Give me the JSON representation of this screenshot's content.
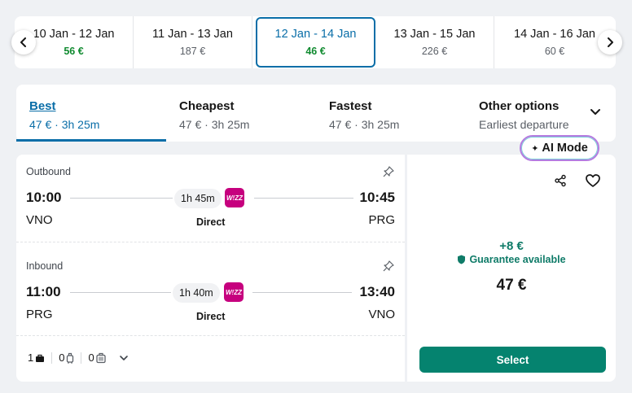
{
  "date_strip": {
    "dates": [
      {
        "range": "10 Jan - 12 Jan",
        "price": "56 €"
      },
      {
        "range": "11 Jan - 13 Jan",
        "price": "187 €"
      },
      {
        "range": "12 Jan - 14 Jan",
        "price": "46 €"
      },
      {
        "range": "13 Jan - 15 Jan",
        "price": "226 €"
      },
      {
        "range": "14 Jan - 16 Jan",
        "price": "60 €"
      }
    ],
    "prev_icon": "chevron-left-icon",
    "next_icon": "chevron-right-icon"
  },
  "sort_tabs": [
    {
      "title": "Best",
      "subtitle": "47 € · 3h 25m"
    },
    {
      "title": "Cheapest",
      "subtitle": "47 € · 3h 25m"
    },
    {
      "title": "Fastest",
      "subtitle": "47 € · 3h 25m"
    },
    {
      "title": "Other options",
      "subtitle": "Earliest departure"
    }
  ],
  "ai_mode": {
    "label": "AI Mode",
    "icon": "sparkle-icon"
  },
  "outbound": {
    "label": "Outbound",
    "dep_time": "10:00",
    "arr_time": "10:45",
    "duration": "1h 45m",
    "dep_code": "VNO",
    "arr_code": "PRG",
    "stops": "Direct",
    "airline_logo": "W!ZZ"
  },
  "inbound": {
    "label": "Inbound",
    "dep_time": "11:00",
    "arr_time": "13:40",
    "duration": "1h 40m",
    "dep_code": "PRG",
    "arr_code": "VNO",
    "stops": "Direct",
    "airline_logo": "W!ZZ"
  },
  "bags": {
    "personal": "1",
    "cabin": "0",
    "checked": "0"
  },
  "price_panel": {
    "extra": "+8 €",
    "guarantee": "Guarantee available",
    "total": "47 €",
    "select_label": "Select"
  },
  "colors": {
    "accent": "#0a6ea8",
    "green_price": "#0f8a2f",
    "select_button": "#05836f",
    "guarantee_text": "#0f7b68",
    "airline": "#c6007e"
  }
}
